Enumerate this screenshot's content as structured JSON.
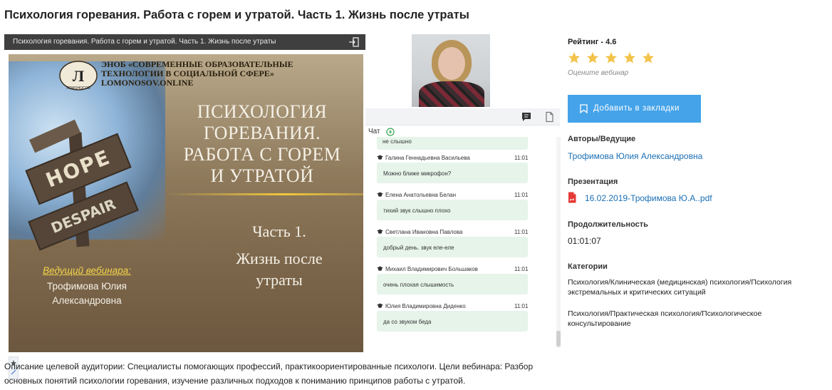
{
  "page": {
    "title": "Психология горевания. Работа с горем и утратой. Часть 1. Жизнь после утраты"
  },
  "player": {
    "bar_title": "Психология горевания. Работа с горем и утратой. Часть 1. Жизнь после утраты",
    "slide": {
      "org_line1": "ЭНОБ «СОВРЕМЕННЫЕ ОБРАЗОВАТЕЛЬНЫЕ",
      "org_line2": "ТЕХНОЛОГИИ В СОЦИАЛЬНОЙ СФЕРЕ»",
      "org_site": "LOMONOSOV.ONLINE",
      "logo_text": "ЛОМОНОСОВ",
      "sign_hope": "HOPE",
      "sign_despair": "DESPAIR",
      "title_line1": "ПСИХОЛОГИЯ",
      "title_line2": "ГОРЕВАНИЯ.",
      "title_line3": "РАБОТА С ГОРЕМ",
      "title_line4": "И УТРАТОЙ",
      "part": "Часть 1.",
      "part_sub_line1": "Жизнь после",
      "part_sub_line2": "утраты",
      "host_label": "Ведущий вебинара:",
      "host_line1": "Трофимова Юлия",
      "host_line2": "Александровна"
    }
  },
  "chat": {
    "label": "Чат",
    "top_message": "не слышно",
    "messages": [
      {
        "name": "Галина Геннадьевна Васильева",
        "time": "11:01",
        "text": "Можно ближе микрофон?"
      },
      {
        "name": "Елена Анатольевна Белан",
        "time": "11:01",
        "text": "тихий звук слышно плохо"
      },
      {
        "name": "Светлана Ивановна Павлова",
        "time": "11:01",
        "text": "добрый день. звук еле-еле"
      },
      {
        "name": "Михаил Владимирович Большаков",
        "time": "11:01",
        "text": "очень плохая слышимость"
      },
      {
        "name": "Юлия Владимировна Диденко",
        "time": "11:01",
        "text": "да со звуком беда"
      }
    ]
  },
  "side": {
    "rating_label": "Рейтинг - 4.6",
    "rating_value": 4.6,
    "rating_max": 5,
    "rate_hint": "Оцените вебинар",
    "bookmark_label": "Добавить в закладки",
    "authors_label": "Авторы/Ведущие",
    "author_name": "Трофимова Юлия Александровна",
    "presentation_label": "Презентация",
    "presentation_file": "16.02.2019-Трофимова Ю.А..pdf",
    "duration_label": "Продолжительность",
    "duration_value": "01:01:07",
    "categories_label": "Категории",
    "categories": [
      "Психология/Клиническая (медицинская) психология/Психология экстремальных и критических ситуаций",
      "Психология/Практическая психология/Психологическое консультирование"
    ]
  },
  "description": "Описание целевой аудитории: Специалисты помогающих профессий, практикоориентированные психологи. Цели вебинара: Разбор основных понятий психологии горевания, изучение различных подходов к пониманию принципов работы с утратой.",
  "colors": {
    "accent_button": "#44a3e9",
    "link": "#1a6fb5",
    "star_filled": "#f3c34a",
    "star_empty": "#dfe5ec",
    "chat_bubble": "#e6f4ea"
  }
}
